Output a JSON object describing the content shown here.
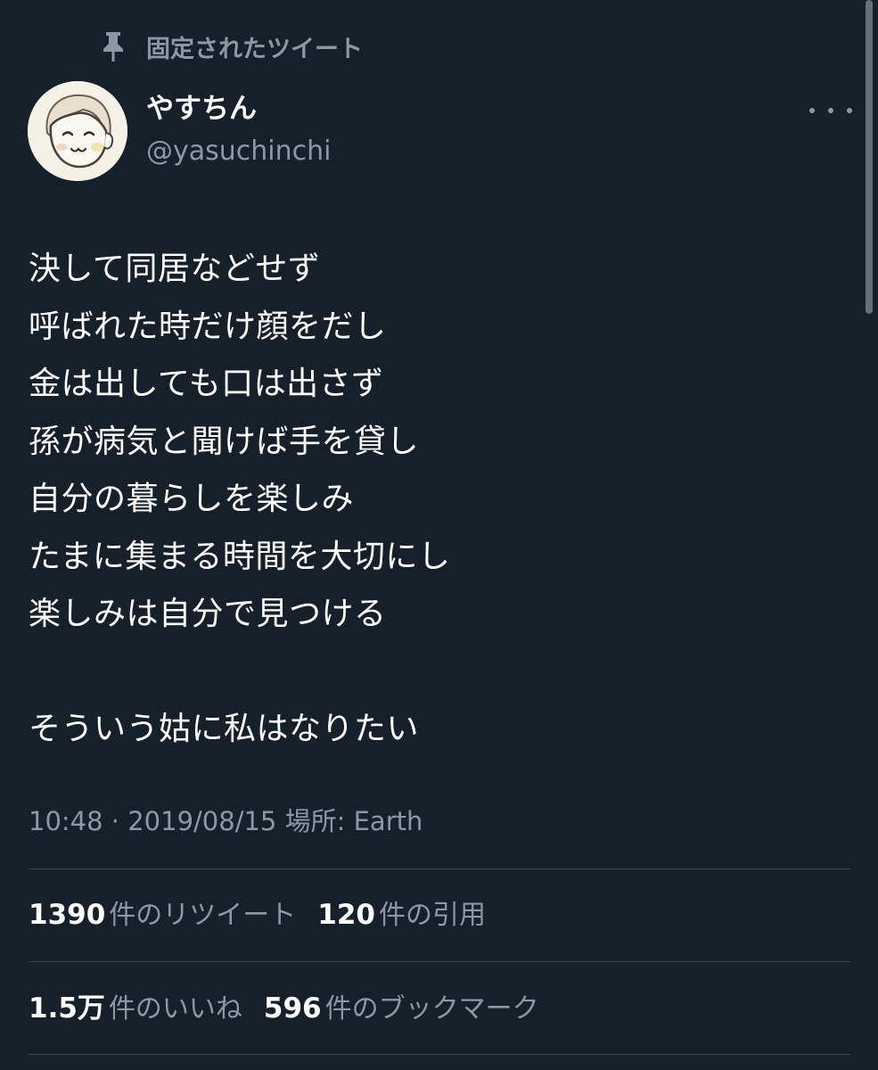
{
  "pinned": {
    "icon": "pin-icon",
    "label": "固定されたツイート"
  },
  "author": {
    "display_name": "やすちん",
    "handle": "@yasuchinchi",
    "avatar": "avatar-illustration"
  },
  "more_icon": "more-options-icon",
  "tweet": {
    "lines": [
      "決して同居などせず",
      "呼ばれた時だけ顔をだし",
      "金は出しても口は出さず",
      "孫が病気と聞けば手を貸し",
      "自分の暮らしを楽しみ",
      "たまに集まる時間を大切にし",
      "楽しみは自分で見つける"
    ],
    "closing": "そういう姑に私はなりたい"
  },
  "meta": {
    "time": "10:48",
    "separator": "·",
    "date": "2019/08/15",
    "location_label": "場所:",
    "location": "Earth"
  },
  "stats": {
    "retweets": {
      "count": "1390",
      "label": "件のリツイート"
    },
    "quotes": {
      "count": "120",
      "label": "件の引用"
    },
    "likes": {
      "count": "1.5万",
      "label": "件のいいね"
    },
    "bookmarks": {
      "count": "596",
      "label": "件のブックマーク"
    }
  },
  "colors": {
    "background": "#15202b",
    "primary_text": "#ffffff",
    "secondary_text": "#8b98a5",
    "divider": "#38444d"
  }
}
